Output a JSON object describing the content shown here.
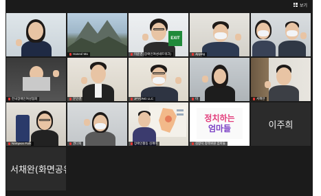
{
  "toolbar": {
    "view_label": "보기"
  },
  "participants": [
    {
      "name": ""
    },
    {
      "name": "Haneol Ma"
    },
    {
      "name": "이윤경 (장애인여성네트워크)"
    },
    {
      "name": "Jipying"
    },
    {
      "name": ""
    },
    {
      "name": "한국장애인여성협회"
    },
    {
      "name": "문인경"
    },
    {
      "name": "JPYONG LLC"
    },
    {
      "name": "이"
    },
    {
      "name": "서혜란"
    },
    {
      "name": "Namjeon Park"
    },
    {
      "name": "권다희"
    },
    {
      "name": "장애인활동 김혜미"
    },
    {
      "name": "김창덕 정책위원 엄마들"
    },
    {
      "name": "이주희"
    },
    {
      "name": "서채완(화면공유용"
    }
  ],
  "sign": {
    "line1": "정치하는",
    "line2": "엄마들",
    "exit_text": "EXIT"
  },
  "colors": {
    "background": "#1b1b1b",
    "tile": "#2b2b2b",
    "sign_pink": "#e23b7a",
    "sign_purple": "#7a3fc4"
  }
}
